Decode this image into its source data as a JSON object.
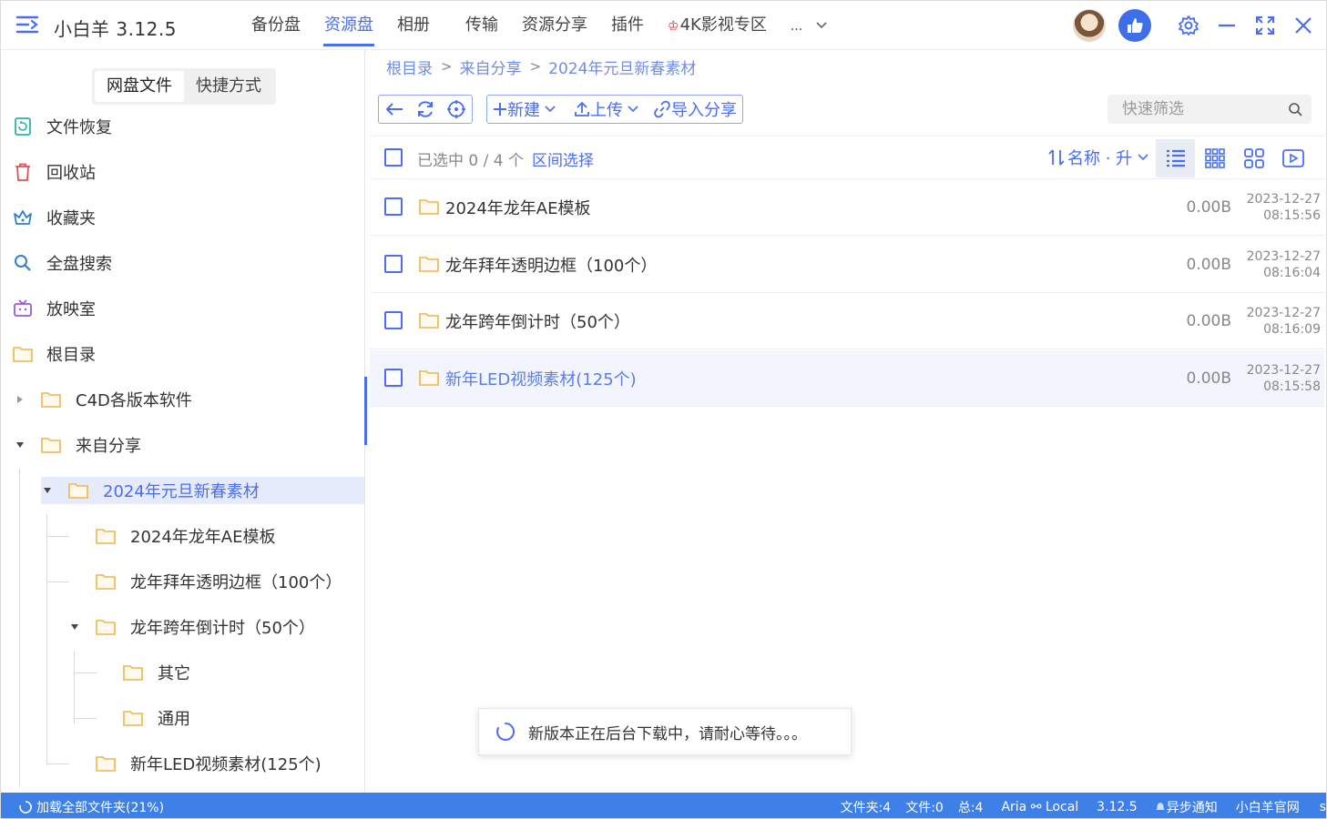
{
  "app": {
    "title": "小白羊 3.12.5",
    "accent": "#4a6ef0",
    "statusbar_color": "#3f7fe8"
  },
  "nav": [
    {
      "label": "备份盘"
    },
    {
      "label": "资源盘"
    },
    {
      "label": "相册"
    },
    {
      "label": "传输"
    },
    {
      "label": "资源分享"
    },
    {
      "label": "插件"
    },
    {
      "label": "4K影视专区"
    },
    {
      "label": "..."
    }
  ],
  "sidebar": {
    "tabs": [
      "网盘文件",
      "快捷方式"
    ],
    "items": [
      {
        "label": "文件恢复",
        "icon": "recover-icon"
      },
      {
        "label": "回收站",
        "icon": "trash-icon"
      },
      {
        "label": "收藏夹",
        "icon": "crown-icon"
      },
      {
        "label": "全盘搜索",
        "icon": "search-icon"
      },
      {
        "label": "放映室",
        "icon": "tv-icon"
      },
      {
        "label": "根目录",
        "icon": "folder-icon"
      }
    ],
    "tree": [
      {
        "label": "C4D各版本软件"
      },
      {
        "label": "来自分享"
      },
      {
        "label": "2024年元旦新春素材"
      },
      {
        "label": "2024年龙年AE模板"
      },
      {
        "label": "龙年拜年透明边框（100个）"
      },
      {
        "label": "龙年跨年倒计时（50个）"
      },
      {
        "label": "其它"
      },
      {
        "label": "通用"
      },
      {
        "label": "新年LED视频素材(125个)"
      }
    ]
  },
  "breadcrumb": [
    "根目录",
    "来自分享",
    "2024年元旦新春素材"
  ],
  "toolbar": {
    "new_label": "新建",
    "upload_label": "上传",
    "import_label": "导入分享"
  },
  "search": {
    "placeholder": "快速筛选"
  },
  "list_header": {
    "selected": "已选中 0 / 4 个",
    "range_select": "区间选择",
    "sort": "名称 · 升"
  },
  "files": [
    {
      "name": "2024年龙年AE模板",
      "size": "0.00B",
      "date": "2023-12-27",
      "time": "08:15:56"
    },
    {
      "name": "龙年拜年透明边框（100个）",
      "size": "0.00B",
      "date": "2023-12-27",
      "time": "08:16:04"
    },
    {
      "name": "龙年跨年倒计时（50个）",
      "size": "0.00B",
      "date": "2023-12-27",
      "time": "08:16:09"
    },
    {
      "name": "新年LED视频素材(125个)",
      "size": "0.00B",
      "date": "2023-12-27",
      "time": "08:15:58"
    }
  ],
  "toast": "新版本正在后台下载中，请耐心等待。。。",
  "statusbar": {
    "loading": "加载全部文件夹(21%)",
    "folders": "文件夹:4",
    "files": "文件:0",
    "total": "总:4",
    "aria": "Aria ⚯ Local",
    "version": "3.12.5",
    "async": "异步通知",
    "site": "小白羊官网",
    "tail": "s"
  }
}
